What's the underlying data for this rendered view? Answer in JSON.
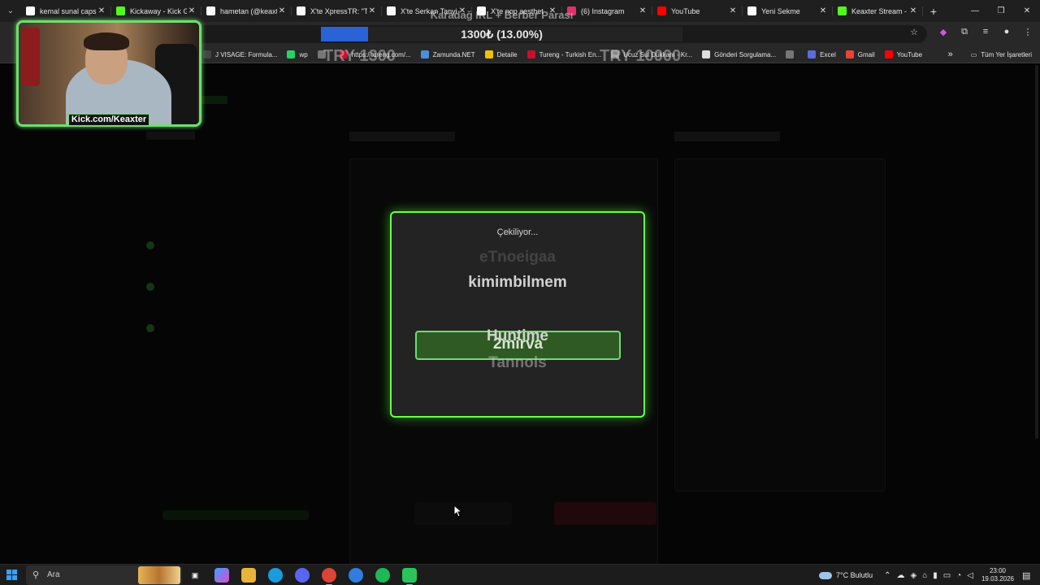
{
  "browser": {
    "tabs": [
      {
        "label": "kemal sunal caps",
        "color": "#ffffff"
      },
      {
        "label": "Kickaway - Kick G",
        "color": "#53fc18"
      },
      {
        "label": "hametan (@keaxt",
        "color": "#ffffff"
      },
      {
        "label": "X'te XpressTR: \"Ta",
        "color": "#ffffff"
      },
      {
        "label": "X'te Serkan Tanyi",
        "color": "#ffffff"
      },
      {
        "label": "X'te nop aesthet",
        "color": "#ffffff"
      },
      {
        "label": "(6) Instagram",
        "color": "#e1306c"
      },
      {
        "label": "YouTube",
        "color": "#ff0000"
      },
      {
        "label": "Yeni Sekme",
        "color": "#ffffff"
      },
      {
        "label": "Keaxter Stream - I",
        "color": "#53fc18"
      }
    ],
    "new_tab": "+",
    "bookmarks": [
      {
        "label": "J VISAGE: Formula...",
        "color": "#444444"
      },
      {
        "label": "wp",
        "color": "#25d366"
      },
      {
        "label": "",
        "color": "#777777"
      },
      {
        "label": "https://tureng.com/...",
        "color": "#c8102e"
      },
      {
        "label": "Zamunda.NET",
        "color": "#4a90d9"
      },
      {
        "label": "Detaile",
        "color": "#f2c200"
      },
      {
        "label": "Tureng - Turkish En...",
        "color": "#c8102e"
      },
      {
        "label": "Ucuz Sul Dükkanı - Kr...",
        "color": "#888888"
      },
      {
        "label": "Gönderi Sorgulama...",
        "color": "#dddddd"
      },
      {
        "label": "",
        "color": "#777777"
      },
      {
        "label": "Excel",
        "color": "#5b6cd9"
      },
      {
        "label": "Gmail",
        "color": "#ea4335"
      },
      {
        "label": "YouTube",
        "color": "#ff0000"
      }
    ],
    "bookmarks_overflow": "»",
    "all_bookmarks": "Tüm Yer İşaretleri"
  },
  "overlay": {
    "title": "Karadağ IRL + Berber Parası",
    "progress_text": "1300₺ (13.00%)",
    "progress_fraction": 0.13,
    "left_amount": "TRY 1300",
    "right_amount": "TRY 10000"
  },
  "webcam": {
    "label": "Kick.com/Keaxter"
  },
  "modal": {
    "status": "Çekiliyor...",
    "names": [
      "eTnoeigaa",
      "kimimbilmem",
      "2mirva",
      "Huntime",
      "Tannols"
    ],
    "winner_index": 2
  },
  "taskbar": {
    "search_placeholder": "Ara",
    "weather": "7°C  Bulutlu",
    "time": "23:00",
    "date": "19.03.2026"
  },
  "colors": {
    "modal_border": "#6bff4a",
    "winner_bg": "#2f5a24",
    "progress_fill": "#2a63d6"
  }
}
